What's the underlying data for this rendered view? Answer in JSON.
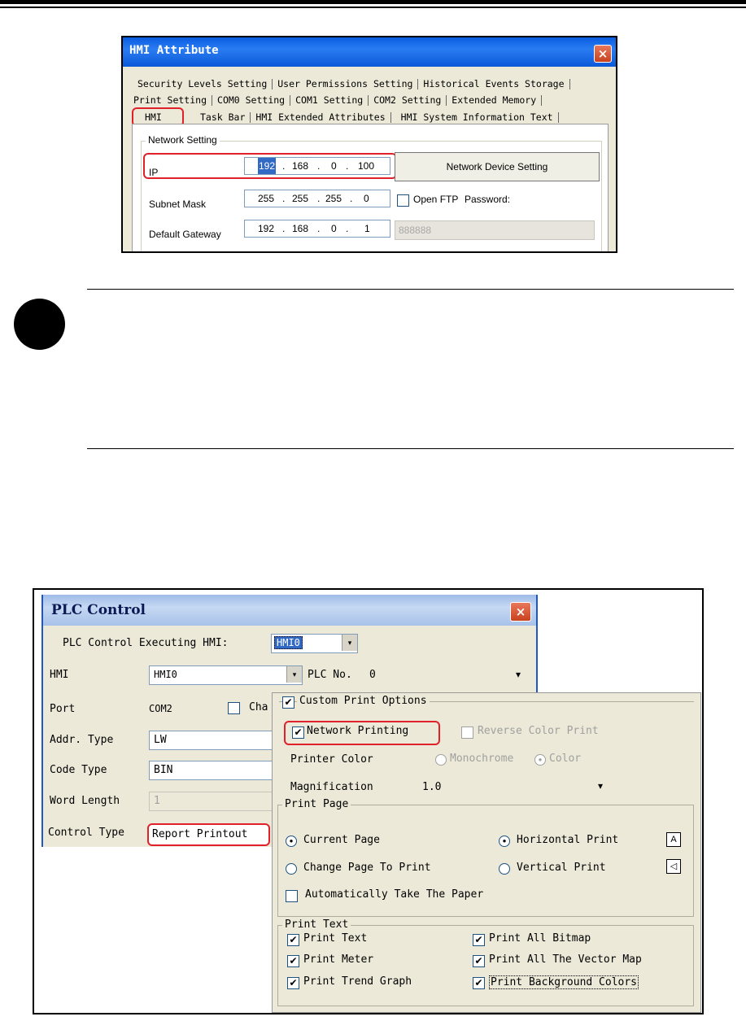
{
  "hmi_dialog": {
    "title": "HMI Attribute",
    "close_glyph": "×",
    "tab_rows": [
      [
        "Security Levels Setting",
        "User Permissions Setting",
        "Historical Events Storage"
      ],
      [
        "Print Setting",
        "COM0 Setting",
        "COM1 Setting",
        "COM2 Setting",
        "Extended Memory"
      ],
      [
        "HMI",
        "Task Bar",
        "HMI Extended Attributes",
        "HMI System Information Text"
      ]
    ],
    "group_title": "Network Setting",
    "ip_label": "IP",
    "ip": [
      "192",
      "168",
      "0",
      "100"
    ],
    "network_device_button": "Network Device Setting",
    "subnet_label": "Subnet Mask",
    "subnet": [
      "255",
      "255",
      "255",
      "0"
    ],
    "open_ftp_label": "Open FTP",
    "password_label": "Password:",
    "gateway_label": "Default Gateway",
    "gateway": [
      "192",
      "168",
      "0",
      "1"
    ],
    "password_value": "888888",
    "dot": "."
  },
  "plc_dialog": {
    "title": "PLC Control",
    "executing_label": "PLC Control Executing HMI:",
    "executing_value": "HMI0",
    "hmi_label": "HMI",
    "hmi_value": "HMI0",
    "plc_no_label": "PLC No.",
    "plc_no_value": "0",
    "port_label": "Port",
    "port_value": "COM2",
    "cha_label": "Cha",
    "addr_label": "Addr. Type",
    "addr_value": "LW",
    "code_label": "Code Type",
    "code_value": "BIN",
    "word_label": "Word Length",
    "word_value": "1",
    "control_label": "Control Type",
    "control_value": "Report Printout"
  },
  "print_options": {
    "custom_label": "Custom Print Options",
    "network_printing": "Network Printing",
    "reverse_color": "Reverse Color Print",
    "printer_color_label": "Printer Color",
    "monochrome": "Monochrome",
    "color": "Color",
    "magnification_label": "Magnification",
    "magnification_value": "1.0",
    "print_page_title": "Print Page",
    "current_page": "Current Page",
    "horizontal_print": "Horizontal Print",
    "change_page": "Change Page To Print",
    "vertical_print": "Vertical Print",
    "auto_paper": "Automatically Take The Paper",
    "print_text_title": "Print Text",
    "items": [
      {
        "label": "Print Text"
      },
      {
        "label": "Print All Bitmap"
      },
      {
        "label": "Print Meter"
      },
      {
        "label": "Print All The Vector Map"
      },
      {
        "label": "Print Trend Graph"
      },
      {
        "label": "Print Background Colors"
      }
    ],
    "check_glyph": "✔",
    "radio_glyph": "●",
    "drop_glyph": "▾",
    "horizontal_icon": "A",
    "vertical_icon": "◁"
  }
}
